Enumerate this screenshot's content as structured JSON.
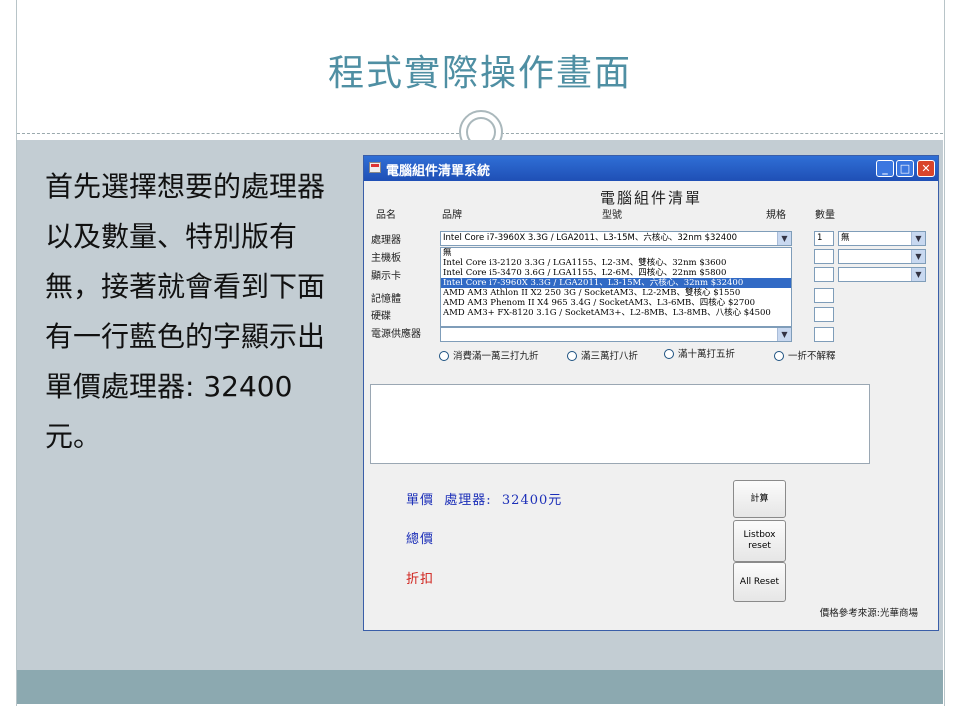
{
  "slide": {
    "title": "程式實際操作畫面",
    "body_text": "首先選擇想要的處理器以及數量、特別版有無，接著就會看到下面有一行藍色的字顯示出單價處理器: 32400元。"
  },
  "window": {
    "title": "電腦組件清單系統",
    "controls": {
      "minimize": "_",
      "maximize": "□",
      "close": "✕"
    },
    "heading": "電腦組件清單",
    "column_headers": {
      "name": "品名",
      "brand": "品牌",
      "model": "型號",
      "spec": "規格",
      "quantity": "數量"
    },
    "row_labels": [
      "處理器",
      "主機板",
      "顯示卡",
      "記憶體",
      "硬碟",
      "電源供應器"
    ],
    "cpu_combo_value": "Intel Core i7-3960X 3.3G / LGA2011、L3-15M、六核心、32nm $32400",
    "cpu_quantity": "1",
    "cpu_special_value": "無",
    "listbox_items": [
      "無",
      "Intel Core i3-2120 3.3G / LGA1155、L2-3M、雙核心、32nm $3600",
      "Intel Core i5-3470 3.6G / LGA1155、L2-6M、四核心、22nm $5800",
      "Intel Core i7-3960X 3.3G / LGA2011、L3-15M、六核心、32nm $32400",
      "AMD AM3 Athlon II X2 250 3G / SocketAM3、L2-2MB、雙核心 $1550",
      "AMD AM3 Phenom II X4 965 3.4G / SocketAM3、L3-6MB、四核心 $2700",
      "AMD AM3+ FX-8120 3.1G / SocketAM3+、L2-8MB、L3-8MB、八核心 $4500"
    ],
    "listbox_selected": "Intel Core i7-3960X 3.3G / LGA2011、L3-15M、六核心、32nm $32400",
    "radios": [
      "消費滿一萬三打九折",
      "滿三萬打八折",
      "滿十萬打五折",
      "一折不解釋"
    ],
    "unit_price_line": "單價  處理器:  32400元",
    "total_label": "總價",
    "discount_label": "折扣",
    "buttons": {
      "calculate": "計算",
      "listbox_reset": "Listbox reset",
      "all_reset": "All Reset"
    },
    "footnote": "價格參考來源:光華商場"
  },
  "colors": {
    "title_color": "#4f8fa3",
    "content_bg": "#c3cdd3",
    "bottom_bar": "#8ca9b0",
    "unit_price_blue": "#1c2fb8",
    "discount_red": "#d0201a",
    "selection_blue": "#316ac5"
  }
}
